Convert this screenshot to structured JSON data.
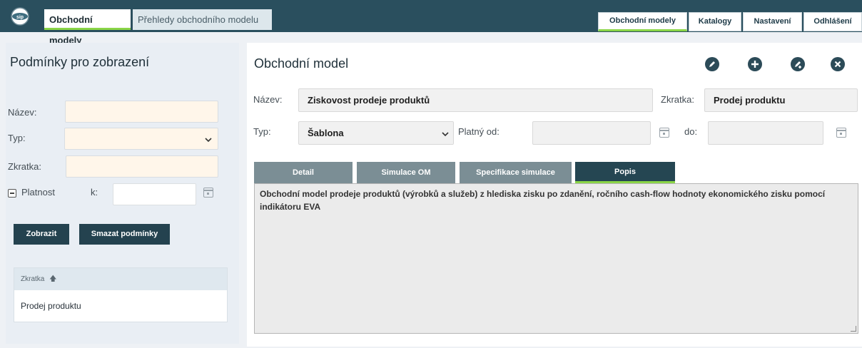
{
  "header": {
    "tabs": [
      {
        "label": "Obchodní modely",
        "active": true
      },
      {
        "label": "Přehledy obchodního modelu",
        "active": false
      }
    ],
    "nav": [
      {
        "label": "Obchodní modely"
      },
      {
        "label": "Katalogy"
      },
      {
        "label": "Nastavení"
      },
      {
        "label": "Odhlášení"
      }
    ]
  },
  "filter": {
    "title": "Podmínky pro zobrazení",
    "name_label": "Název:",
    "type_label": "Typ:",
    "abbr_label": "Zkratka:",
    "validity_label": "Platnost",
    "validity_k_label": "k:",
    "show_button": "Zobrazit",
    "clear_button": "Smazat podmínky",
    "list": {
      "header": "Zkratka",
      "rows": [
        "Prodej produktu"
      ]
    }
  },
  "model": {
    "title": "Obchodní model",
    "name_label": "Název:",
    "name_value": "Ziskovost prodeje produktů",
    "abbr_label": "Zkratka:",
    "abbr_value": "Prodej produktu",
    "type_label": "Typ:",
    "type_value": "Šablona",
    "valid_from_label": "Platný od:",
    "valid_to_label": "do:",
    "tabs": [
      {
        "label": "Detail",
        "active": false
      },
      {
        "label": "Simulace OM",
        "active": false
      },
      {
        "label": "Specifikace simulace",
        "active": false
      },
      {
        "label": "Popis",
        "active": true
      }
    ],
    "description": "Obchodní model prodeje produktů (výrobků a služeb) z hlediska zisku po zdanění, ročního cash-flow hodnoty ekonomického zisku pomocí indikátoru EVA"
  },
  "colors": {
    "header_bg": "#2a4f5e",
    "accent_green": "#8ad547",
    "dark_button": "#24424f"
  }
}
